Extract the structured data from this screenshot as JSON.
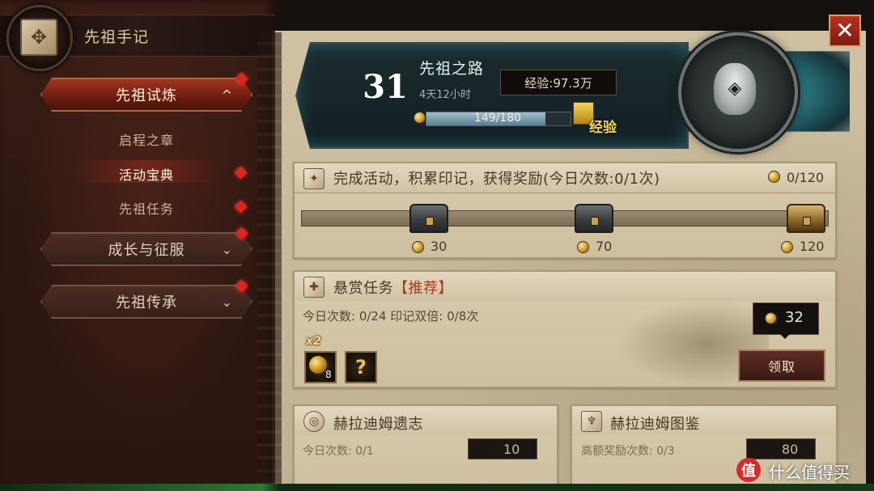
{
  "panel": {
    "title": "先祖手记",
    "nav": [
      {
        "label": "先祖试炼",
        "expanded": true,
        "chevron": "^"
      },
      {
        "label": "成长与征服",
        "expanded": false,
        "chevron": "⌄"
      },
      {
        "label": "先祖传承",
        "expanded": false,
        "chevron": "⌄"
      }
    ],
    "sub_items": [
      "启程之章",
      "活动宝典",
      "先祖任务"
    ],
    "selected_sub_item": "活动宝典"
  },
  "header": {
    "level": "31",
    "title": "先祖之路",
    "time_left": "4天12小时",
    "exp_badge": "经验:97.3万",
    "progress_text": "149/180",
    "progress_fraction": 0.828,
    "exp_label": "经验"
  },
  "activity": {
    "title": "完成活动，积累印记，获得奖励(今日次数:0/1次)",
    "total": "0/120",
    "milestones": [
      {
        "value": "30",
        "chest": "iron"
      },
      {
        "value": "70",
        "chest": "iron"
      },
      {
        "value": "120",
        "chest": "gold"
      }
    ]
  },
  "bounty": {
    "title": "悬赏任务",
    "tag": "【推荐】",
    "stats": "今日次数: 0/24 印记双倍: 0/8次",
    "reward": "32",
    "claim_label": "领取",
    "item_multiplier": "x2",
    "item_count": "8",
    "item_unknown": "?"
  },
  "bottom_cards": [
    {
      "title": "赫拉迪姆遗志",
      "stats": "今日次数: 0/1",
      "reward": "10"
    },
    {
      "title": "赫拉迪姆图鉴",
      "stats": "高额奖励次数: 0/3",
      "reward": "80"
    }
  ],
  "watermark": {
    "logo": "值",
    "text": "什么值得买"
  },
  "colors": {
    "accent_red": "#b8331d",
    "parchment": "#cfc1a2",
    "teal_glow": "#6fd6d2",
    "gold": "#f5d55a"
  },
  "icons": [
    "book-icon",
    "close-icon",
    "chevron-up-icon",
    "chevron-down-icon",
    "coin-icon",
    "chest-icon",
    "skull-emblem-icon",
    "scroll-icon",
    "question-icon"
  ]
}
